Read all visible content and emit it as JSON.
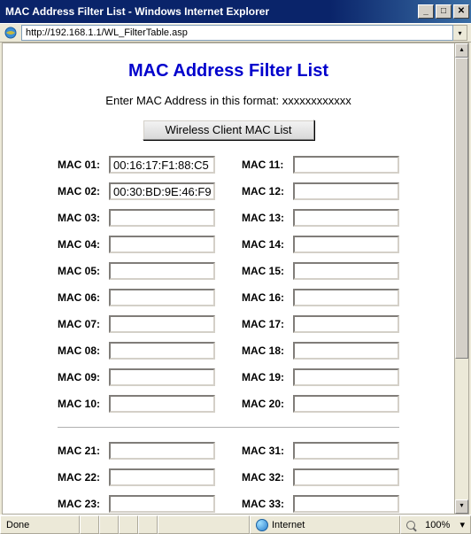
{
  "window": {
    "title": "MAC Address Filter List - Windows Internet Explorer",
    "url": "http://192.168.1.1/WL_FilterTable.asp"
  },
  "page": {
    "heading": "MAC Address Filter List",
    "subtitle": "Enter MAC Address in this format: xxxxxxxxxxxx",
    "button_label": "Wireless Client MAC List"
  },
  "mac": {
    "left1": [
      {
        "label": "MAC 01:",
        "value": "00:16:17:F1:88:C5"
      },
      {
        "label": "MAC 02:",
        "value": "00:30:BD:9E:46:F9"
      },
      {
        "label": "MAC 03:",
        "value": ""
      },
      {
        "label": "MAC 04:",
        "value": ""
      },
      {
        "label": "MAC 05:",
        "value": ""
      },
      {
        "label": "MAC 06:",
        "value": ""
      },
      {
        "label": "MAC 07:",
        "value": ""
      },
      {
        "label": "MAC 08:",
        "value": ""
      },
      {
        "label": "MAC 09:",
        "value": ""
      },
      {
        "label": "MAC 10:",
        "value": ""
      }
    ],
    "right1": [
      {
        "label": "MAC 11:",
        "value": ""
      },
      {
        "label": "MAC 12:",
        "value": ""
      },
      {
        "label": "MAC 13:",
        "value": ""
      },
      {
        "label": "MAC 14:",
        "value": ""
      },
      {
        "label": "MAC 15:",
        "value": ""
      },
      {
        "label": "MAC 16:",
        "value": ""
      },
      {
        "label": "MAC 17:",
        "value": ""
      },
      {
        "label": "MAC 18:",
        "value": ""
      },
      {
        "label": "MAC 19:",
        "value": ""
      },
      {
        "label": "MAC 20:",
        "value": ""
      }
    ],
    "left2": [
      {
        "label": "MAC 21:",
        "value": ""
      },
      {
        "label": "MAC 22:",
        "value": ""
      },
      {
        "label": "MAC 23:",
        "value": ""
      }
    ],
    "right2": [
      {
        "label": "MAC 31:",
        "value": ""
      },
      {
        "label": "MAC 32:",
        "value": ""
      },
      {
        "label": "MAC 33:",
        "value": ""
      }
    ]
  },
  "status": {
    "done": "Done",
    "zone": "Internet",
    "zoom": "100%"
  }
}
